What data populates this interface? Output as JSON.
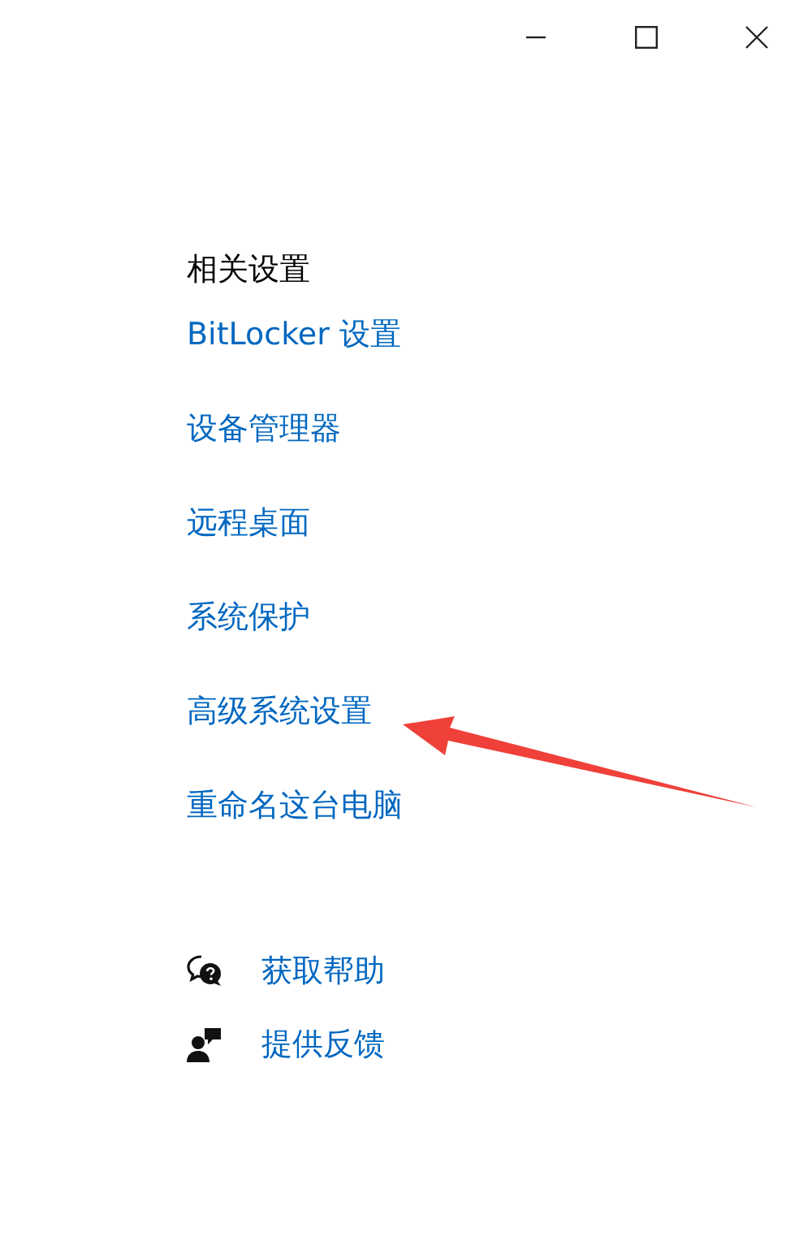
{
  "window": {
    "controls": [
      {
        "kind": "minimize"
      },
      {
        "kind": "maximize"
      },
      {
        "kind": "close"
      }
    ]
  },
  "related_settings": {
    "heading": "相关设置",
    "links": [
      "BitLocker 设置",
      "设备管理器",
      "远程桌面",
      "系统保护",
      "高级系统设置",
      "重命名这台电脑"
    ]
  },
  "support": [
    {
      "kind": "help",
      "label": "获取帮助"
    },
    {
      "kind": "feedback",
      "label": "提供反馈"
    }
  ]
}
